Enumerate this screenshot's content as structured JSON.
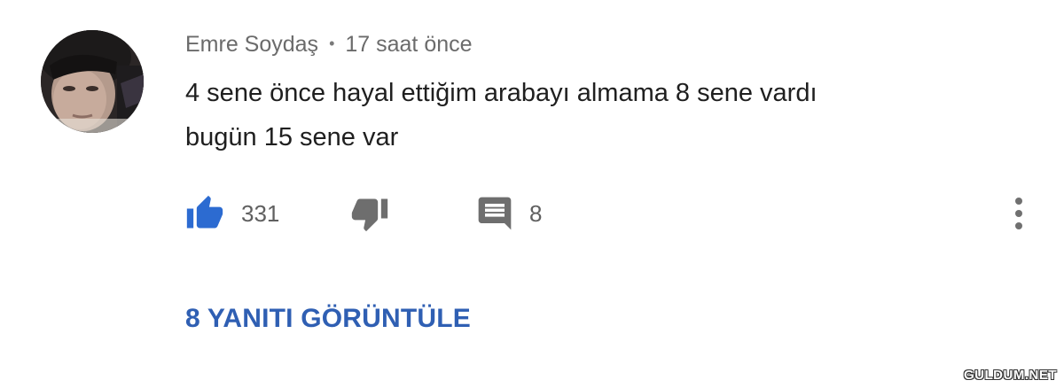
{
  "comment": {
    "author": "Emre Soydaş",
    "separator": "•",
    "timestamp": "17 saat önce",
    "text_lines": [
      "4 sene önce hayal ettiğim arabayı almama 8 sene vardı",
      "bugün 15 sene var"
    ],
    "like_count": "331",
    "reply_count": "8",
    "view_replies_label": "8 YANITI GÖRÜNTÜLE"
  },
  "icons": {
    "like": "thumbs-up-icon",
    "dislike": "thumbs-down-icon",
    "reply": "comment-icon",
    "more": "more-vert-icon"
  },
  "colors": {
    "like_active": "#2c6bd1",
    "icon_gray": "#6e6e6e",
    "link_blue": "#2f5fb3"
  },
  "watermark": "GULDUM.NET"
}
